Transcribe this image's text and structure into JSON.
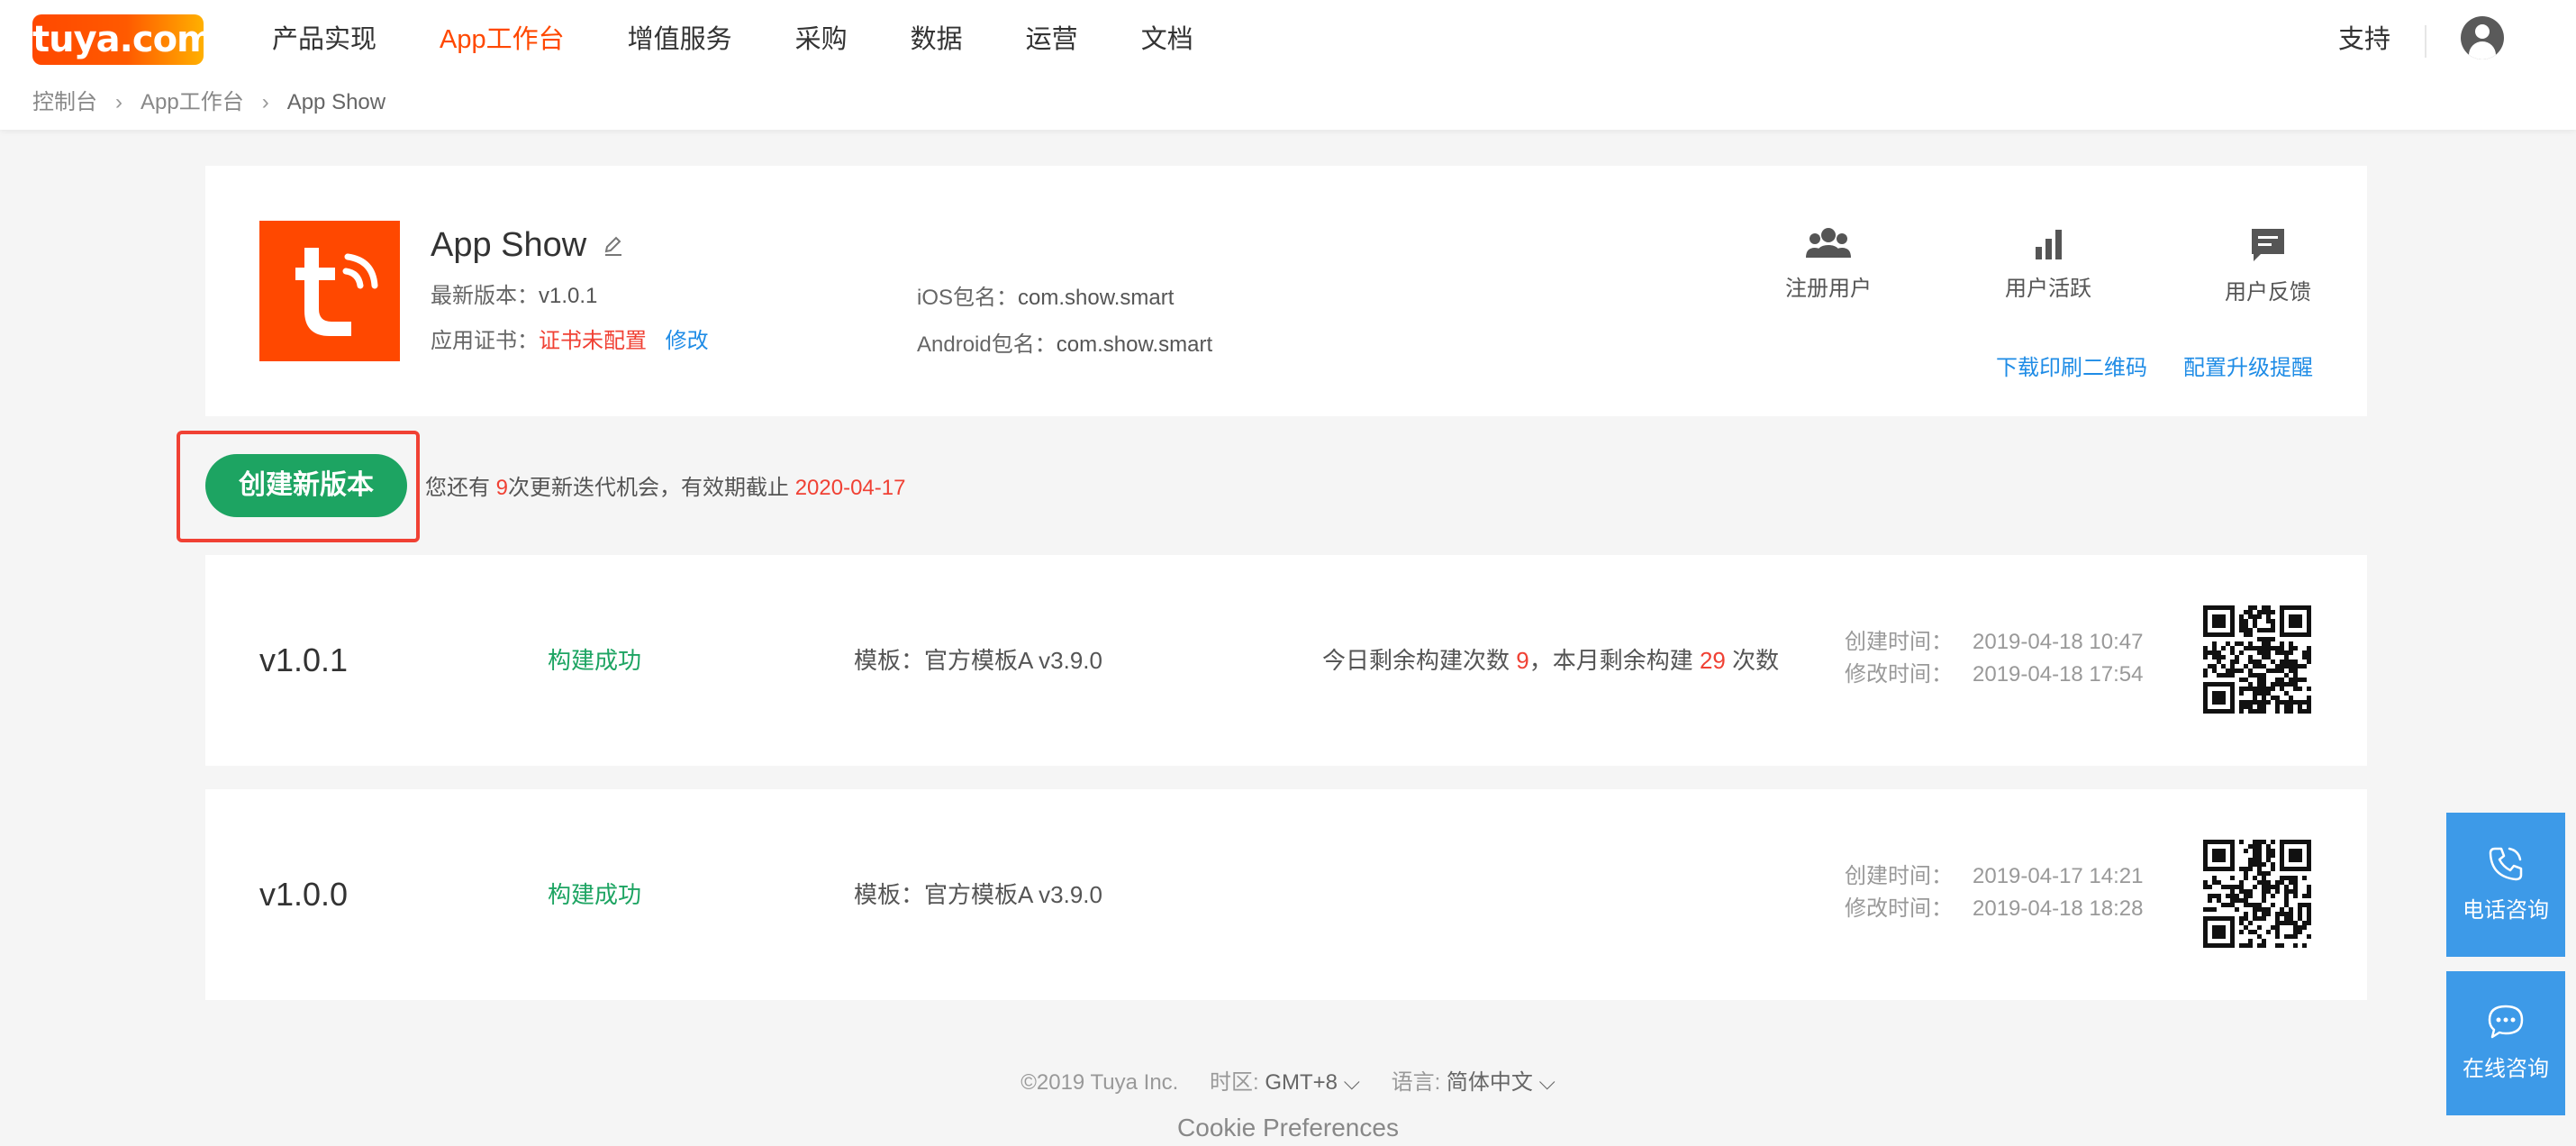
{
  "brand": {
    "logo_text": "tuya.com",
    "accent": "#ff4800",
    "primary_green": "#1da462",
    "link_blue": "#1f8ce6",
    "warn_red": "#f04134"
  },
  "nav": {
    "items": [
      "产品实现",
      "App工作台",
      "增值服务",
      "采购",
      "数据",
      "运营",
      "文档"
    ],
    "active": "App工作台",
    "support": "支持"
  },
  "breadcrumb": {
    "items": [
      "控制台",
      "App工作台",
      "App Show"
    ]
  },
  "app": {
    "name": "App Show",
    "latest_version_label": "最新版本：",
    "latest_version": "v1.0.1",
    "cert_label": "应用证书：",
    "cert_status": "证书未配置",
    "cert_action": "修改",
    "ios_label": "iOS包名：",
    "ios_bundle": "com.show.smart",
    "android_label": "Android包名：",
    "android_bundle": "com.show.smart"
  },
  "stats": {
    "registered_users": "注册用户",
    "active_users": "用户活跃",
    "feedback": "用户反馈",
    "download_qr": "下载印刷二维码",
    "upgrade_reminder": "配置升级提醒"
  },
  "create": {
    "button": "创建新版本",
    "hint_pre": "您还有 ",
    "remaining": "9",
    "hint_mid": "次更新迭代机会，有效期截止 ",
    "deadline": "2020-04-17"
  },
  "versions": [
    {
      "version": "v1.0.1",
      "status": "构建成功",
      "template": "模板：官方模板A v3.9.0",
      "quota_pre": "今日剩余构建次数 ",
      "today_left": "9",
      "quota_mid": "，本月剩余构建 ",
      "month_left": "29",
      "quota_post": " 次数",
      "created_label": "创建时间：",
      "created": "2019-04-18 10:47",
      "modified_label": "修改时间：",
      "modified": "2019-04-18 17:54"
    },
    {
      "version": "v1.0.0",
      "status": "构建成功",
      "template": "模板：官方模板A v3.9.0",
      "created_label": "创建时间：",
      "created": "2019-04-17 14:21",
      "modified_label": "修改时间：",
      "modified": "2019-04-18 18:28"
    }
  ],
  "footer": {
    "copyright": "©2019 Tuya Inc.",
    "timezone_label": "时区:",
    "timezone": "GMT+8",
    "language_label": "语言:",
    "language": "简体中文",
    "cookie": "Cookie Preferences"
  },
  "float": {
    "phone": "电话咨询",
    "chat": "在线咨询"
  }
}
